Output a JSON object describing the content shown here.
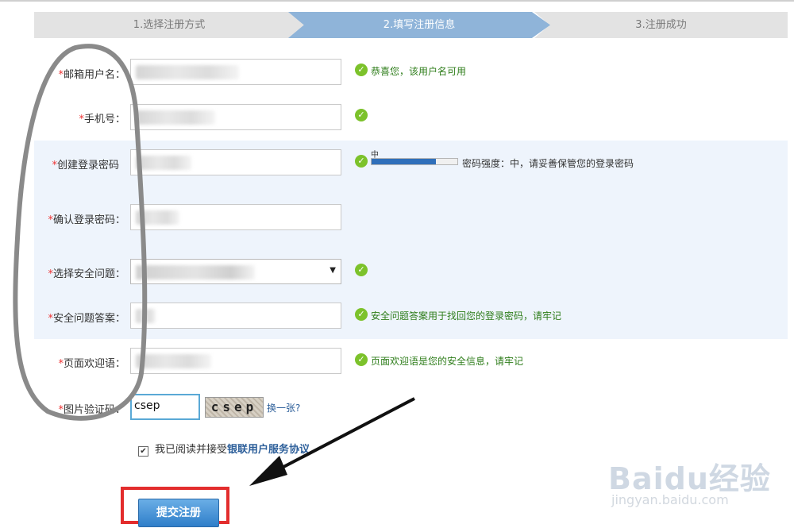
{
  "steps": [
    {
      "label": "1.选择注册方式"
    },
    {
      "label": "2.填写注册信息"
    },
    {
      "label": "3.注册成功"
    }
  ],
  "form": {
    "required_mark": "*",
    "fields": [
      {
        "label": "邮箱用户名："
      },
      {
        "label": "手机号："
      },
      {
        "label": "创建登录密码"
      },
      {
        "label": "确认登录密码："
      },
      {
        "label": "选择安全问题："
      },
      {
        "label": "安全问题答案："
      },
      {
        "label": "页面欢迎语："
      },
      {
        "label": "图片验证码："
      }
    ],
    "hints": {
      "username": "恭喜您，该用户名可用",
      "answer": "安全问题答案用于找回您的登录密码，请牢记",
      "welcome": "页面欢迎语是您的安全信息，请牢记"
    },
    "password_strength": {
      "level_label": "中",
      "fill_fraction": 0.75,
      "text": "密码强度：中，请妥善保管您的登录密码"
    },
    "captcha": {
      "value": "csep",
      "image_text": "csep",
      "refresh_link": "换一张?"
    }
  },
  "agreement": {
    "prefix": "我已阅读并接受",
    "link": "银联用户服务协议",
    "checked": true
  },
  "submit_label": "提交注册",
  "watermark": {
    "main": "Baidu经验",
    "sub": "jingyan.baidu.com"
  },
  "icons": {
    "ok": "check-circle-icon",
    "caret": "caret-down-icon"
  }
}
